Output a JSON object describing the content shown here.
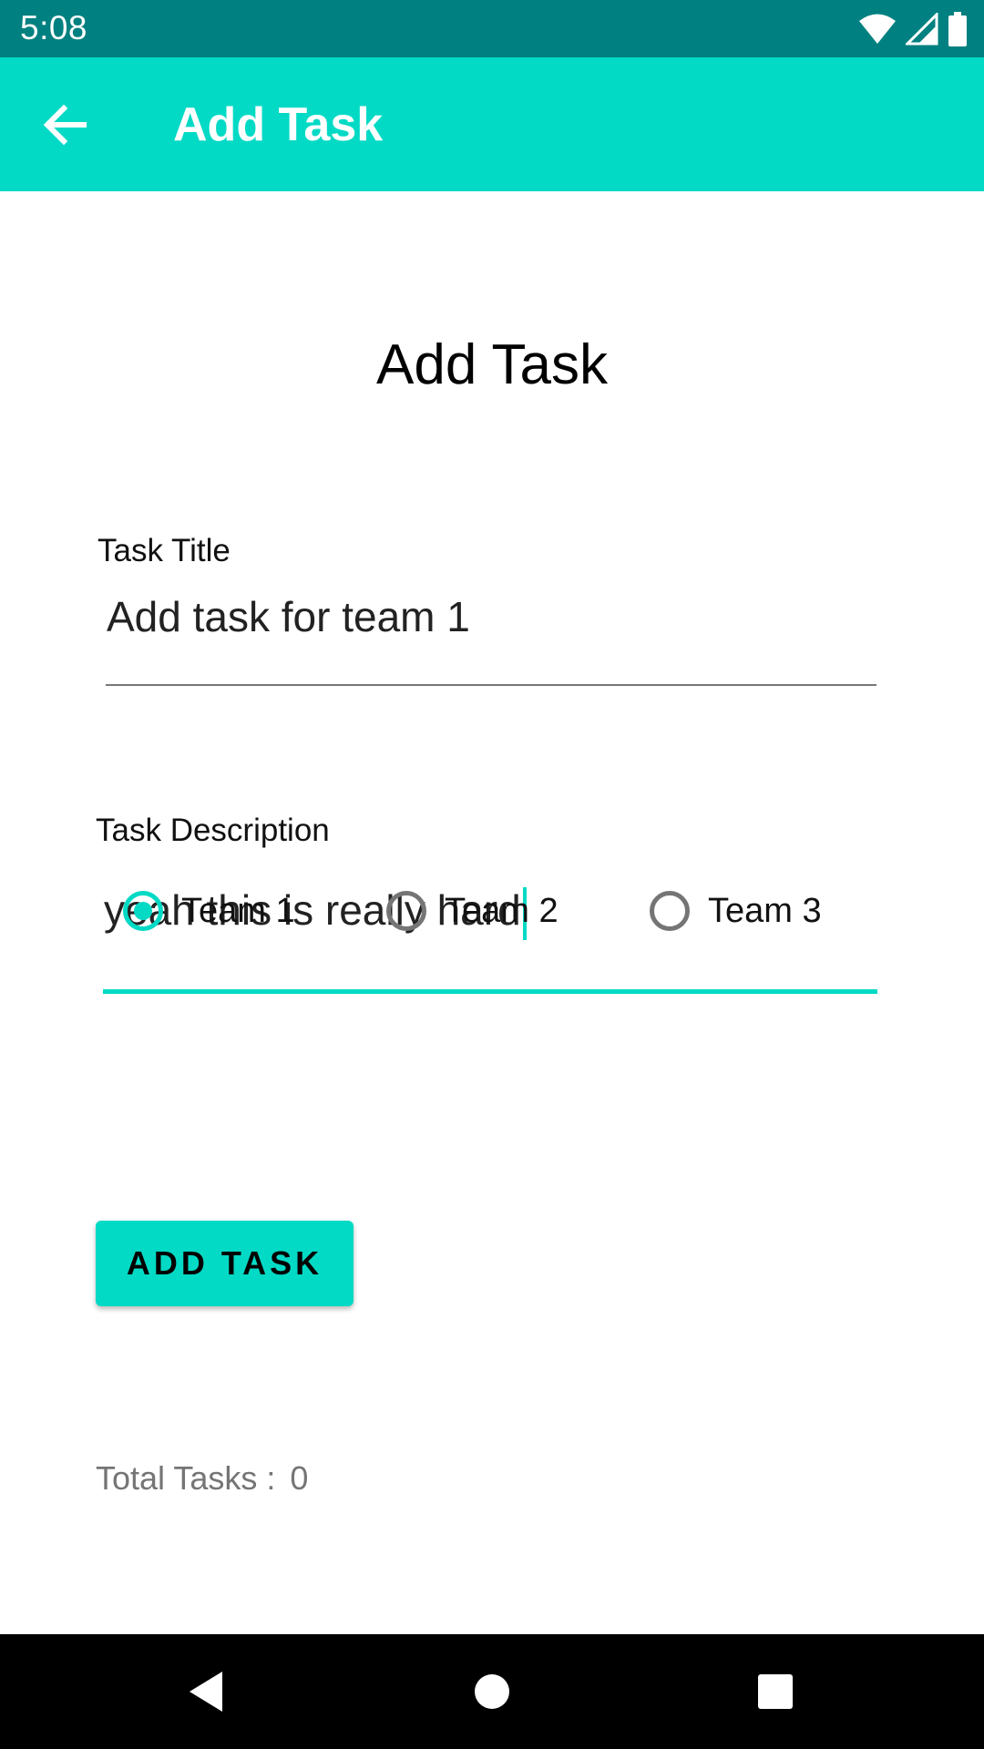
{
  "status_bar": {
    "time": "5:08",
    "icons": [
      "wifi-icon",
      "signal-icon",
      "battery-icon"
    ]
  },
  "app_bar": {
    "title": "Add Task",
    "back_icon": "arrow-back-icon"
  },
  "page": {
    "heading": "Add Task"
  },
  "form": {
    "title_label": "Task Title",
    "title_value": "Add task for team 1",
    "description_label": "Task Description",
    "description_value": "yeah this is really hard"
  },
  "teams": [
    {
      "label": "Team 1",
      "checked": true
    },
    {
      "label": "Team 2",
      "checked": false
    },
    {
      "label": "Team 3",
      "checked": false
    }
  ],
  "add_button_label": "ADD TASK",
  "total": {
    "label": "Total Tasks :",
    "count": "0"
  },
  "colors": {
    "status_bar": "#008080",
    "app_bar": "#03dac5",
    "accent": "#03dac5"
  },
  "nav_bar": {
    "icons": [
      "back-triangle-icon",
      "home-circle-icon",
      "recents-square-icon"
    ]
  }
}
